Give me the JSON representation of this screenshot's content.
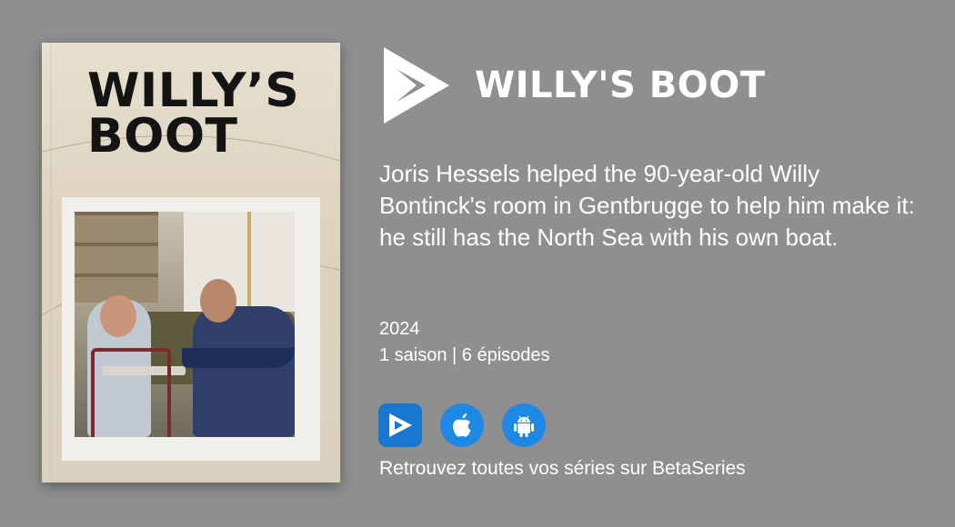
{
  "poster": {
    "title": "WILLY’S\nBOOT"
  },
  "show": {
    "title": "WILLY'S BOOT",
    "description": "Joris Hessels helped the 90-year-old Willy Bontinck's room in Gentbrugge to help him make it: he still has the North Sea with his own boat.",
    "year": "2024",
    "seasons_episodes": "1 saison | 6 épisodes"
  },
  "apps": [
    {
      "icon": "betaseries-icon"
    },
    {
      "icon": "apple-icon"
    },
    {
      "icon": "android-icon"
    }
  ],
  "tagline": "Retrouvez toutes vos séries sur BetaSeries",
  "colors": {
    "background": "#8f8f8f",
    "accent": "#1e88e5",
    "text": "#ffffff"
  }
}
